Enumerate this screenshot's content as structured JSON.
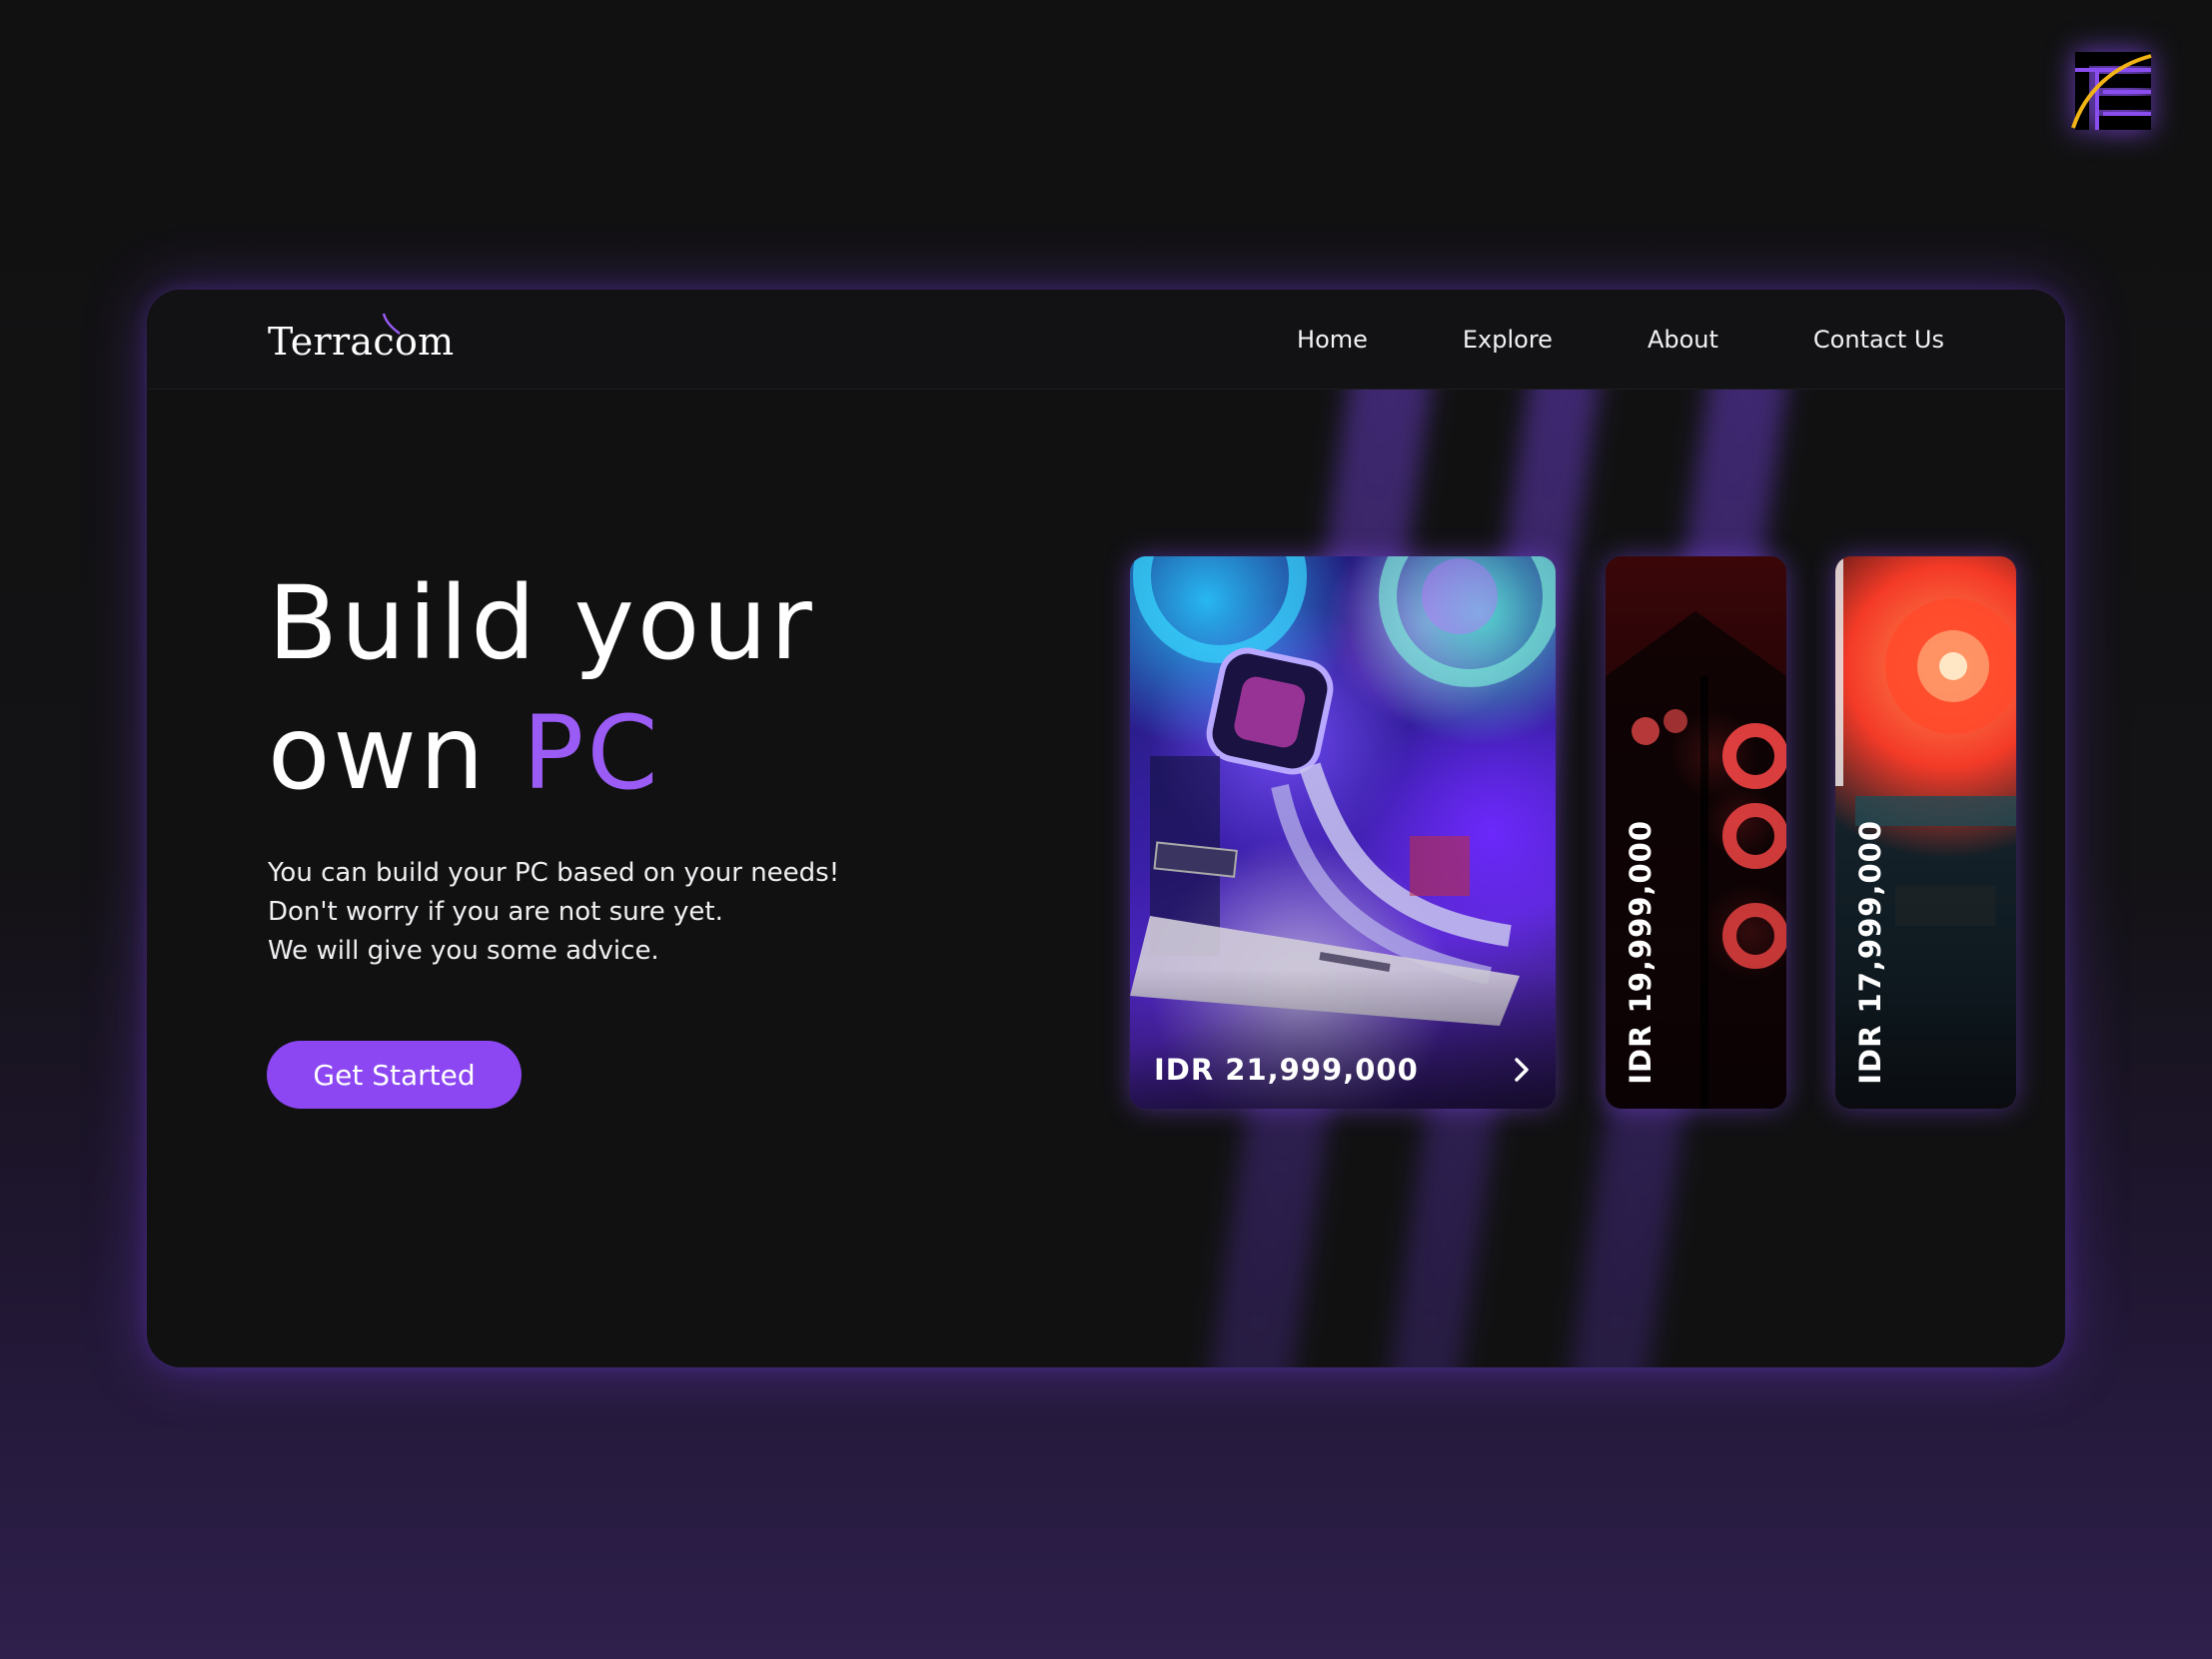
{
  "brand": {
    "name": "Terracom"
  },
  "nav": {
    "links": [
      "Home",
      "Explore",
      "About",
      "Contact Us"
    ]
  },
  "hero": {
    "title_line1": "Build your",
    "title_line2_prefix": "own ",
    "title_accent": "PC",
    "description": [
      "You can build your PC based on your needs!",
      "Don't worry if you are not sure yet.",
      "We will give you some advice."
    ],
    "cta_label": "Get Started"
  },
  "products": [
    {
      "price": "IDR 21,999,000"
    },
    {
      "price": "IDR 19,999,000"
    },
    {
      "price": "IDR 17,999,000"
    }
  ],
  "colors": {
    "accent": "#9a5cf5",
    "button": "#8c47f2",
    "background": "#111112"
  },
  "icons": {
    "corner_logo": "brand-logo-icon",
    "card_arrow": "chevron-right-icon"
  }
}
